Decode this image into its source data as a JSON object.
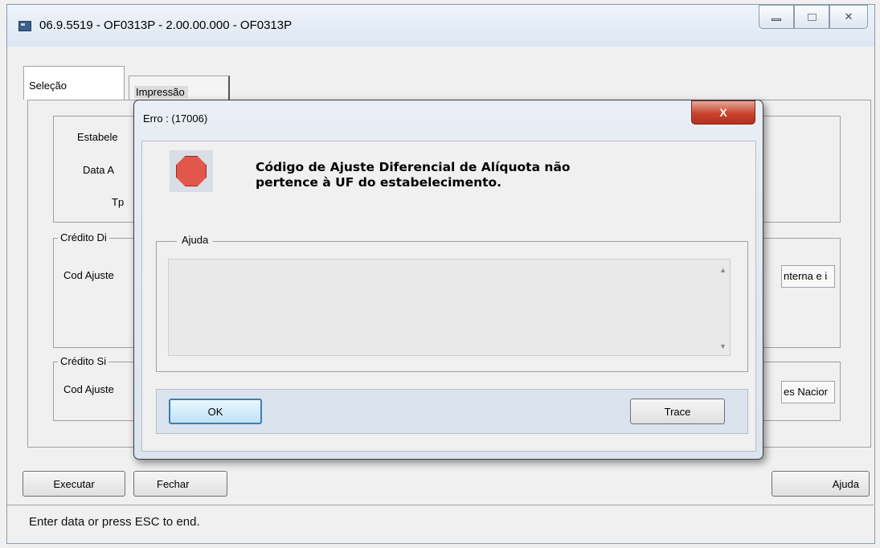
{
  "window": {
    "title": "06.9.5519 - OF0313P - 2.00.00.000 - OF0313P",
    "close_glyph": "✕"
  },
  "tabs": [
    {
      "label": "Seleção",
      "selected": true
    },
    {
      "label": "Impressão",
      "selected": false
    }
  ],
  "form": {
    "label_estabelecimento": "Estabele",
    "label_data": "Data A",
    "label_tp": "Tp",
    "group_credito_dif": "Crédito Di",
    "label_cod_ajuste_1": "Cod Ajuste",
    "field_right_1": "nterna e i",
    "group_credito_si": "Crédito Si",
    "label_cod_ajuste_2": "Cod Ajuste",
    "field_right_2": "es Nacior"
  },
  "buttons": {
    "executar": "Executar",
    "fechar": "Fechar",
    "ajuda": "Ajuda"
  },
  "status_bar": "Enter data or press ESC to end.",
  "dialog": {
    "title": "Erro : (17006)",
    "close_glyph": "X",
    "message_line1": "Código de Ajuste Diferencial de Alíquota não",
    "message_line2": "pertence à UF do estabelecimento.",
    "ajuda_legend": "Ajuda",
    "ajuda_text": "",
    "ok_label": "OK",
    "trace_label": "Trace"
  },
  "icons": {
    "error": "stop-icon",
    "app": "app-icon"
  },
  "colors": {
    "close_button": "#c9432c",
    "stop_icon": "#e2574c",
    "ok_button_border": "#3c7fb1"
  }
}
